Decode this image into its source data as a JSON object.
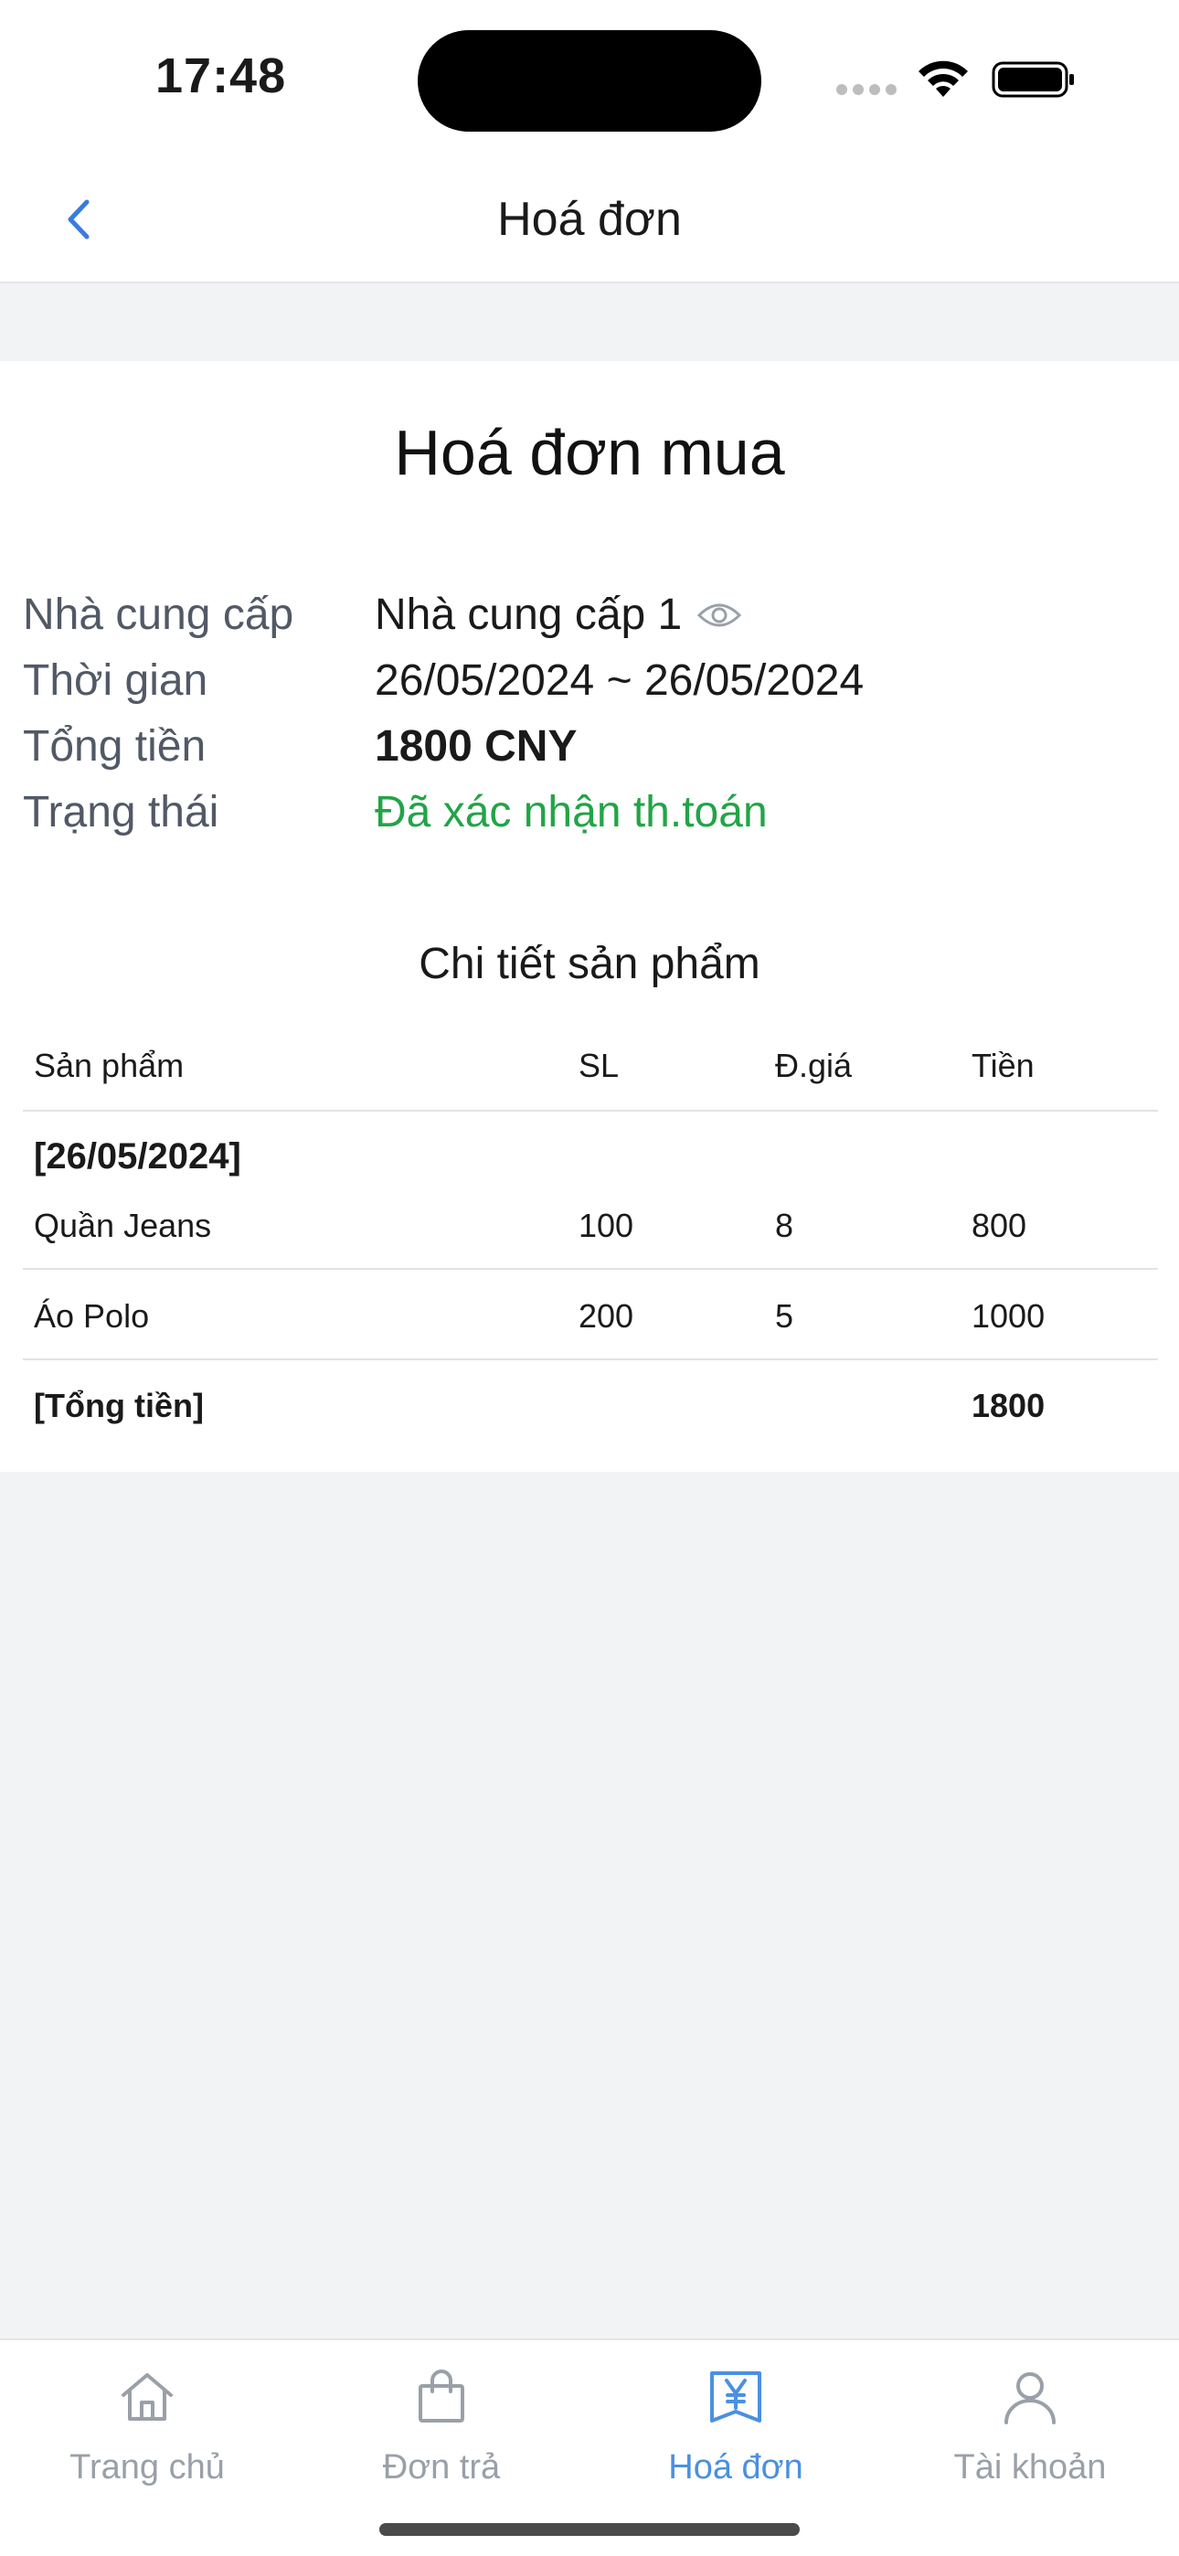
{
  "status_bar": {
    "time": "17:48"
  },
  "nav": {
    "title": "Hoá đơn"
  },
  "invoice": {
    "title": "Hoá đơn mua",
    "fields": [
      {
        "label": "Nhà cung cấp",
        "value": "Nhà cung cấp 1"
      },
      {
        "label": "Thời gian",
        "value": "26/05/2024 ~ 26/05/2024"
      },
      {
        "label": "Tổng tiền",
        "value": "1800 CNY"
      },
      {
        "label": "Trạng thái",
        "value": "Đã xác nhận th.toán"
      }
    ],
    "status_color": "#22a447"
  },
  "details": {
    "title": "Chi tiết sản phẩm",
    "headers": {
      "product": "Sản phẩm",
      "qty": "SL",
      "price": "Đ.giá",
      "amount": "Tiền"
    },
    "group_date": "[26/05/2024]",
    "rows": [
      {
        "product": "Quần Jeans",
        "qty": "100",
        "price": "8",
        "amount": "800"
      },
      {
        "product": "Áo Polo",
        "qty": "200",
        "price": "5",
        "amount": "1000"
      }
    ],
    "total_label": "[Tổng tiền]",
    "total_amount": "1800"
  },
  "tabs": [
    {
      "label": "Trang chủ",
      "icon": "home-icon",
      "active": false
    },
    {
      "label": "Đơn trả",
      "icon": "shopping-bag-icon",
      "active": false
    },
    {
      "label": "Hoá đơn",
      "icon": "invoice-yen-icon",
      "active": true
    },
    {
      "label": "Tài khoản",
      "icon": "user-icon",
      "active": false
    }
  ],
  "colors": {
    "accent": "#4a90e2",
    "inactive": "#9aa0a8",
    "back": "#3a7be0"
  }
}
